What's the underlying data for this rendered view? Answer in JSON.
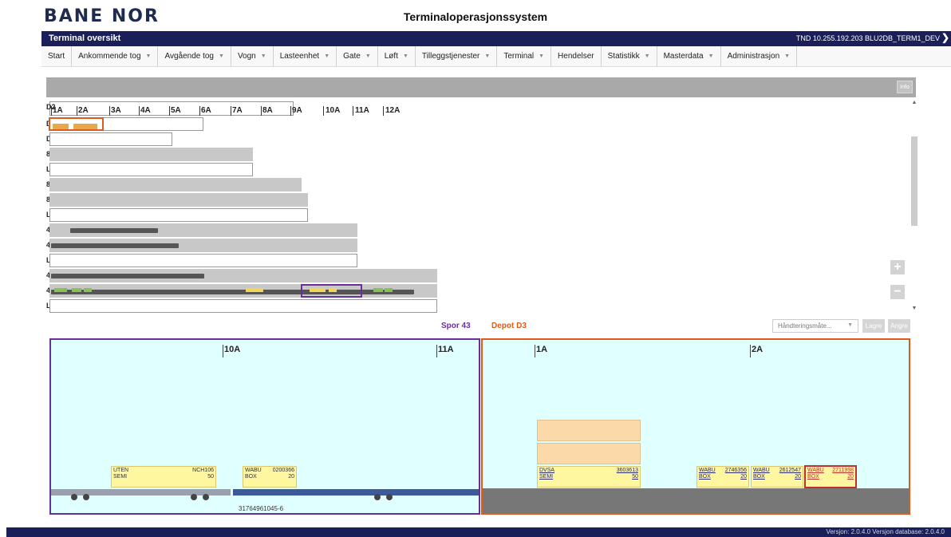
{
  "brand": {
    "logo_text": "BANE NOR"
  },
  "app_title": "Terminaloperasjonssystem",
  "topbar": {
    "title": "Terminal oversikt",
    "connection": "TND 10.255.192.203 BLU2DB_TERM1_DEV",
    "exit_icon": "exit-icon"
  },
  "menu": [
    {
      "label": "Start",
      "dropdown": false
    },
    {
      "label": "Ankommende tog",
      "dropdown": true
    },
    {
      "label": "Avgående tog",
      "dropdown": true
    },
    {
      "label": "Vogn",
      "dropdown": true
    },
    {
      "label": "Lasteenhet",
      "dropdown": true
    },
    {
      "label": "Gate",
      "dropdown": true
    },
    {
      "label": "Løft",
      "dropdown": true
    },
    {
      "label": "Tilleggstjenester",
      "dropdown": true
    },
    {
      "label": "Terminal",
      "dropdown": true
    },
    {
      "label": "Hendelser",
      "dropdown": false
    },
    {
      "label": "Statistikk",
      "dropdown": true
    },
    {
      "label": "Masterdata",
      "dropdown": true
    },
    {
      "label": "Administrasjon",
      "dropdown": true
    }
  ],
  "info_button": "Info",
  "overview": {
    "columns": [
      "1A",
      "2A",
      "3A",
      "4A",
      "5A",
      "6A",
      "7A",
      "8A",
      "9A",
      "10A",
      "11A",
      "12A"
    ],
    "tracks": [
      "D2",
      "D3",
      "D4",
      "83",
      "L2",
      "82",
      "81",
      "L3",
      "48",
      "47",
      "L4",
      "44",
      "43",
      "L5"
    ],
    "zoom_in_icon": "+",
    "zoom_out_icon": "−"
  },
  "detail": {
    "spor_label": "Spor 43",
    "depot_label": "Depot D3",
    "handling_select": "Håndteringsmåte...",
    "save_button": "Lagre",
    "cancel_button": "Angre",
    "left_panel": {
      "ticks": [
        "10A",
        "11A"
      ],
      "units": [
        {
          "owner": "UTEN",
          "number": "NCH106",
          "type": "SEMI",
          "size": "50"
        },
        {
          "owner": "WABU",
          "number": "0200366",
          "type": "BOX",
          "size": "20"
        }
      ],
      "wagon_id": "31764961045-6"
    },
    "right_panel": {
      "ticks": [
        "1A",
        "2A"
      ],
      "units": [
        {
          "owner": "DVSA",
          "number": "3603613",
          "type": "SEMI",
          "size": "50"
        },
        {
          "owner": "WABU",
          "number": "2746356",
          "type": "BOX",
          "size": "20"
        },
        {
          "owner": "WABU",
          "number": "2612547",
          "type": "BOX",
          "size": "20"
        },
        {
          "owner": "WABU",
          "number": "2711998",
          "type": "BOX",
          "size": "20"
        }
      ]
    }
  },
  "footer": {
    "version": "Versjon: 2.0.4.0 Versjon database: 2.0.4.0"
  },
  "colors": {
    "brand_navy": "#1a1f5a",
    "spor_purple": "#6b2e9c",
    "depot_orange": "#e05a1a",
    "panel_bg": "#e0ffff",
    "cargo_yellow": "#fff6a0"
  }
}
